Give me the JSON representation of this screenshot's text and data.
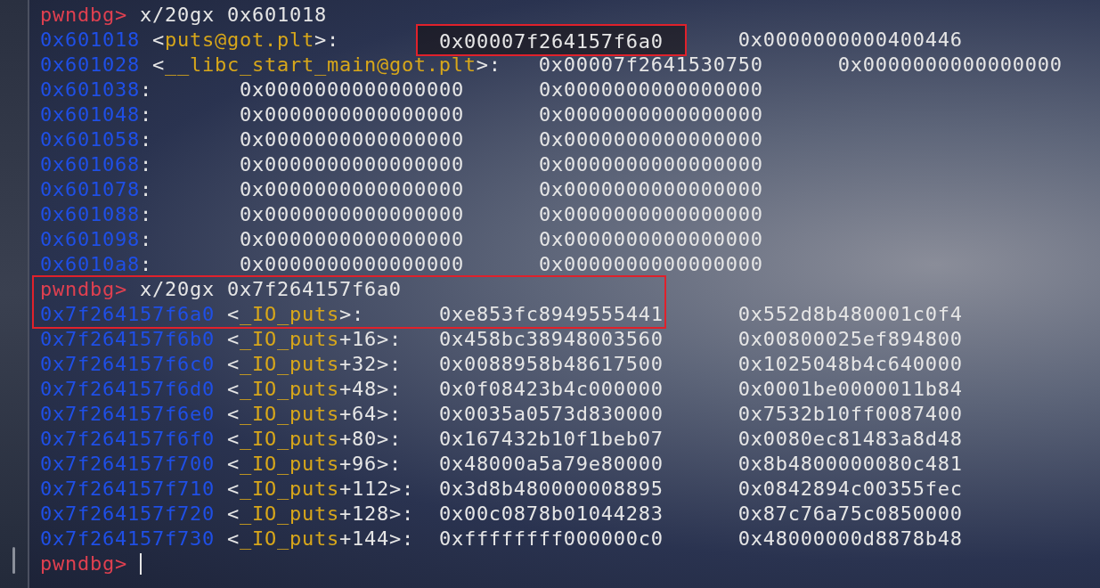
{
  "terminal": {
    "lines": [
      {
        "kind": "command",
        "prompt": "pwndbg>",
        "command": "x/20gx 0x601018",
        "boxed": false
      },
      {
        "kind": "memory",
        "address": "0x601018",
        "open": "<",
        "symbol": "puts@got.plt",
        "rest": ">:",
        "values": [
          {
            "text": "0x00007f264157f6a0",
            "boxed": true
          },
          {
            "text": "0x0000000000400446",
            "boxed": false
          }
        ],
        "boxed": false
      },
      {
        "kind": "memory",
        "address": "0x601028",
        "open": "<",
        "symbol": "__libc_start_main@got.plt",
        "rest": ">:",
        "values": [
          {
            "text": "0x00007f2641530750",
            "boxed": false
          },
          {
            "text": "0x0000000000000000",
            "boxed": false
          }
        ],
        "boxed": false
      },
      {
        "kind": "memory",
        "address": "0x601038",
        "rest": ":",
        "values": [
          {
            "text": "0x0000000000000000",
            "boxed": false
          },
          {
            "text": "0x0000000000000000",
            "boxed": false
          }
        ],
        "boxed": false
      },
      {
        "kind": "memory",
        "address": "0x601048",
        "rest": ":",
        "values": [
          {
            "text": "0x0000000000000000",
            "boxed": false
          },
          {
            "text": "0x0000000000000000",
            "boxed": false
          }
        ],
        "boxed": false
      },
      {
        "kind": "memory",
        "address": "0x601058",
        "rest": ":",
        "values": [
          {
            "text": "0x0000000000000000",
            "boxed": false
          },
          {
            "text": "0x0000000000000000",
            "boxed": false
          }
        ],
        "boxed": false
      },
      {
        "kind": "memory",
        "address": "0x601068",
        "rest": ":",
        "values": [
          {
            "text": "0x0000000000000000",
            "boxed": false
          },
          {
            "text": "0x0000000000000000",
            "boxed": false
          }
        ],
        "boxed": false
      },
      {
        "kind": "memory",
        "address": "0x601078",
        "rest": ":",
        "values": [
          {
            "text": "0x0000000000000000",
            "boxed": false
          },
          {
            "text": "0x0000000000000000",
            "boxed": false
          }
        ],
        "boxed": false
      },
      {
        "kind": "memory",
        "address": "0x601088",
        "rest": ":",
        "values": [
          {
            "text": "0x0000000000000000",
            "boxed": false
          },
          {
            "text": "0x0000000000000000",
            "boxed": false
          }
        ],
        "boxed": false
      },
      {
        "kind": "memory",
        "address": "0x601098",
        "rest": ":",
        "values": [
          {
            "text": "0x0000000000000000",
            "boxed": false
          },
          {
            "text": "0x0000000000000000",
            "boxed": false
          }
        ],
        "boxed": false
      },
      {
        "kind": "memory",
        "address": "0x6010a8",
        "rest": ":",
        "values": [
          {
            "text": "0x0000000000000000",
            "boxed": false
          },
          {
            "text": "0x0000000000000000",
            "boxed": false
          }
        ],
        "boxed": false
      },
      {
        "kind": "command",
        "prompt": "pwndbg>",
        "command": "x/20gx 0x7f264157f6a0",
        "boxed": true
      },
      {
        "kind": "memory",
        "address": "0x7f264157f6a0",
        "open": "<",
        "symbol": "_IO_puts",
        "rest": ">:",
        "values": [
          {
            "text": "0xe853fc8949555441",
            "boxed": false
          },
          {
            "text": "0x552d8b480001c0f4",
            "boxed": false
          }
        ],
        "boxed": true
      },
      {
        "kind": "memory",
        "address": "0x7f264157f6b0",
        "open": "<",
        "symbol": "_IO_puts",
        "rest": "+16>:",
        "values": [
          {
            "text": "0x458bc38948003560",
            "boxed": false
          },
          {
            "text": "0x00800025ef894800",
            "boxed": false
          }
        ],
        "boxed": false
      },
      {
        "kind": "memory",
        "address": "0x7f264157f6c0",
        "open": "<",
        "symbol": "_IO_puts",
        "rest": "+32>:",
        "values": [
          {
            "text": "0x0088958b48617500",
            "boxed": false
          },
          {
            "text": "0x1025048b4c640000",
            "boxed": false
          }
        ],
        "boxed": false
      },
      {
        "kind": "memory",
        "address": "0x7f264157f6d0",
        "open": "<",
        "symbol": "_IO_puts",
        "rest": "+48>:",
        "values": [
          {
            "text": "0x0f08423b4c000000",
            "boxed": false
          },
          {
            "text": "0x0001be0000011b84",
            "boxed": false
          }
        ],
        "boxed": false
      },
      {
        "kind": "memory",
        "address": "0x7f264157f6e0",
        "open": "<",
        "symbol": "_IO_puts",
        "rest": "+64>:",
        "values": [
          {
            "text": "0x0035a0573d830000",
            "boxed": false
          },
          {
            "text": "0x7532b10ff0087400",
            "boxed": false
          }
        ],
        "boxed": false
      },
      {
        "kind": "memory",
        "address": "0x7f264157f6f0",
        "open": "<",
        "symbol": "_IO_puts",
        "rest": "+80>:",
        "values": [
          {
            "text": "0x167432b10f1beb07",
            "boxed": false
          },
          {
            "text": "0x0080ec81483a8d48",
            "boxed": false
          }
        ],
        "boxed": false
      },
      {
        "kind": "memory",
        "address": "0x7f264157f700",
        "open": "<",
        "symbol": "_IO_puts",
        "rest": "+96>:",
        "values": [
          {
            "text": "0x48000a5a79e80000",
            "boxed": false
          },
          {
            "text": "0x8b4800000080c481",
            "boxed": false
          }
        ],
        "boxed": false
      },
      {
        "kind": "memory",
        "address": "0x7f264157f710",
        "open": "<",
        "symbol": "_IO_puts",
        "rest": "+112>:",
        "values": [
          {
            "text": "0x3d8b480000008895",
            "boxed": false
          },
          {
            "text": "0x0842894c00355fec",
            "boxed": false
          }
        ],
        "boxed": false
      },
      {
        "kind": "memory",
        "address": "0x7f264157f720",
        "open": "<",
        "symbol": "_IO_puts",
        "rest": "+128>:",
        "values": [
          {
            "text": "0x00c0878b01044283",
            "boxed": false
          },
          {
            "text": "0x87c76a75c0850000",
            "boxed": false
          }
        ],
        "boxed": false
      },
      {
        "kind": "memory",
        "address": "0x7f264157f730",
        "open": "<",
        "symbol": "_IO_puts",
        "rest": "+144>:",
        "values": [
          {
            "text": "0xffffffff000000c0",
            "boxed": false
          },
          {
            "text": "0x48000000d8878b48",
            "boxed": false
          }
        ],
        "boxed": false
      },
      {
        "kind": "prompt",
        "prompt": "pwndbg>",
        "boxed": false
      }
    ]
  }
}
